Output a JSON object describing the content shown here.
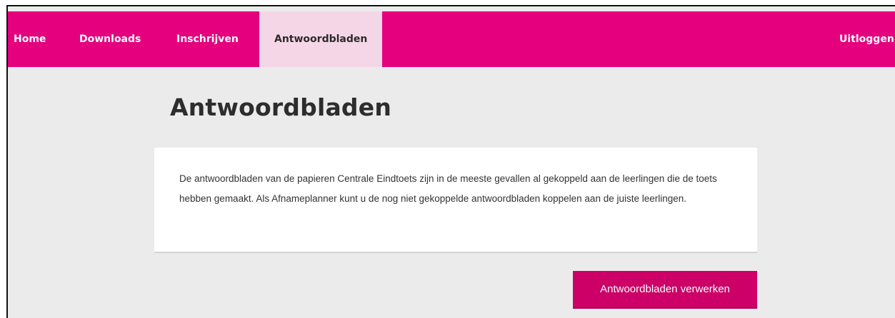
{
  "nav": {
    "home": "Home",
    "downloads": "Downloads",
    "inschrijven": "Inschrijven",
    "antwoordbladen": "Antwoordbladen",
    "uitloggen": "Uitloggen"
  },
  "main": {
    "title": "Antwoordbladen",
    "intro": "De antwoordbladen van de papieren Centrale Eindtoets zijn in de meeste gevallen al gekoppeld aan de leerlingen die de toets hebben gemaakt. Als Afnameplanner kunt u de nog niet gekoppelde antwoordbladen koppelen aan de juiste leerlingen.",
    "button_label": "Antwoordbladen verwerken"
  },
  "colors": {
    "brand": "#e5007d",
    "active_tab": "#f5d6e6",
    "button": "#cc0066",
    "background": "#ebebeb"
  }
}
